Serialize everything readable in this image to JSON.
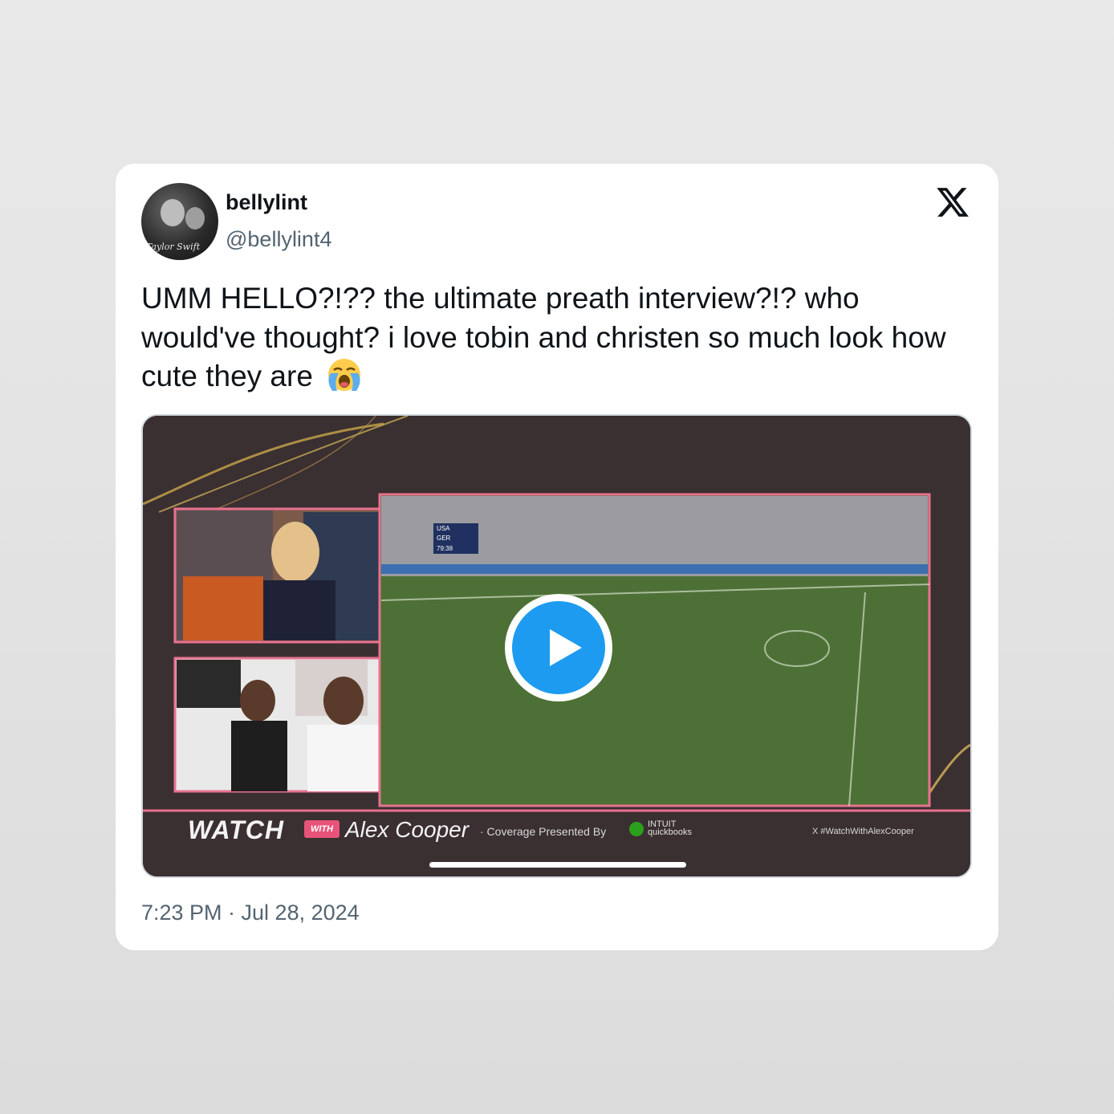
{
  "author": {
    "display_name": "bellylint",
    "handle": "@bellylint4",
    "avatar_icon": "profile-photo",
    "avatar_signature": "Taylor Swift"
  },
  "platform_logo": "x-logo-icon",
  "tweet": {
    "text": "UMM HELLO?!?? the ultimate preath interview?!? who would've thought? i love tobin and christen so much look how cute they are",
    "emoji": "loudly-crying-face"
  },
  "video": {
    "overlay_watch": "WATCH",
    "overlay_with": "WITH",
    "overlay_host": "Alex Cooper",
    "overlay_coverage": "· Coverage Presented By",
    "overlay_sponsor_top": "INTUIT",
    "overlay_sponsor_bottom": "quickbooks",
    "overlay_hashtag": "X #WatchWithAlexCooper",
    "scoreboard_team1": "USA",
    "scoreboard_team2": "GER",
    "scoreboard_clock": "79:38",
    "play_icon": "play-icon",
    "accent_color": "#1d9bf0",
    "frame_color": "#e8728f"
  },
  "timestamp": "7:23 PM · Jul 28, 2024"
}
